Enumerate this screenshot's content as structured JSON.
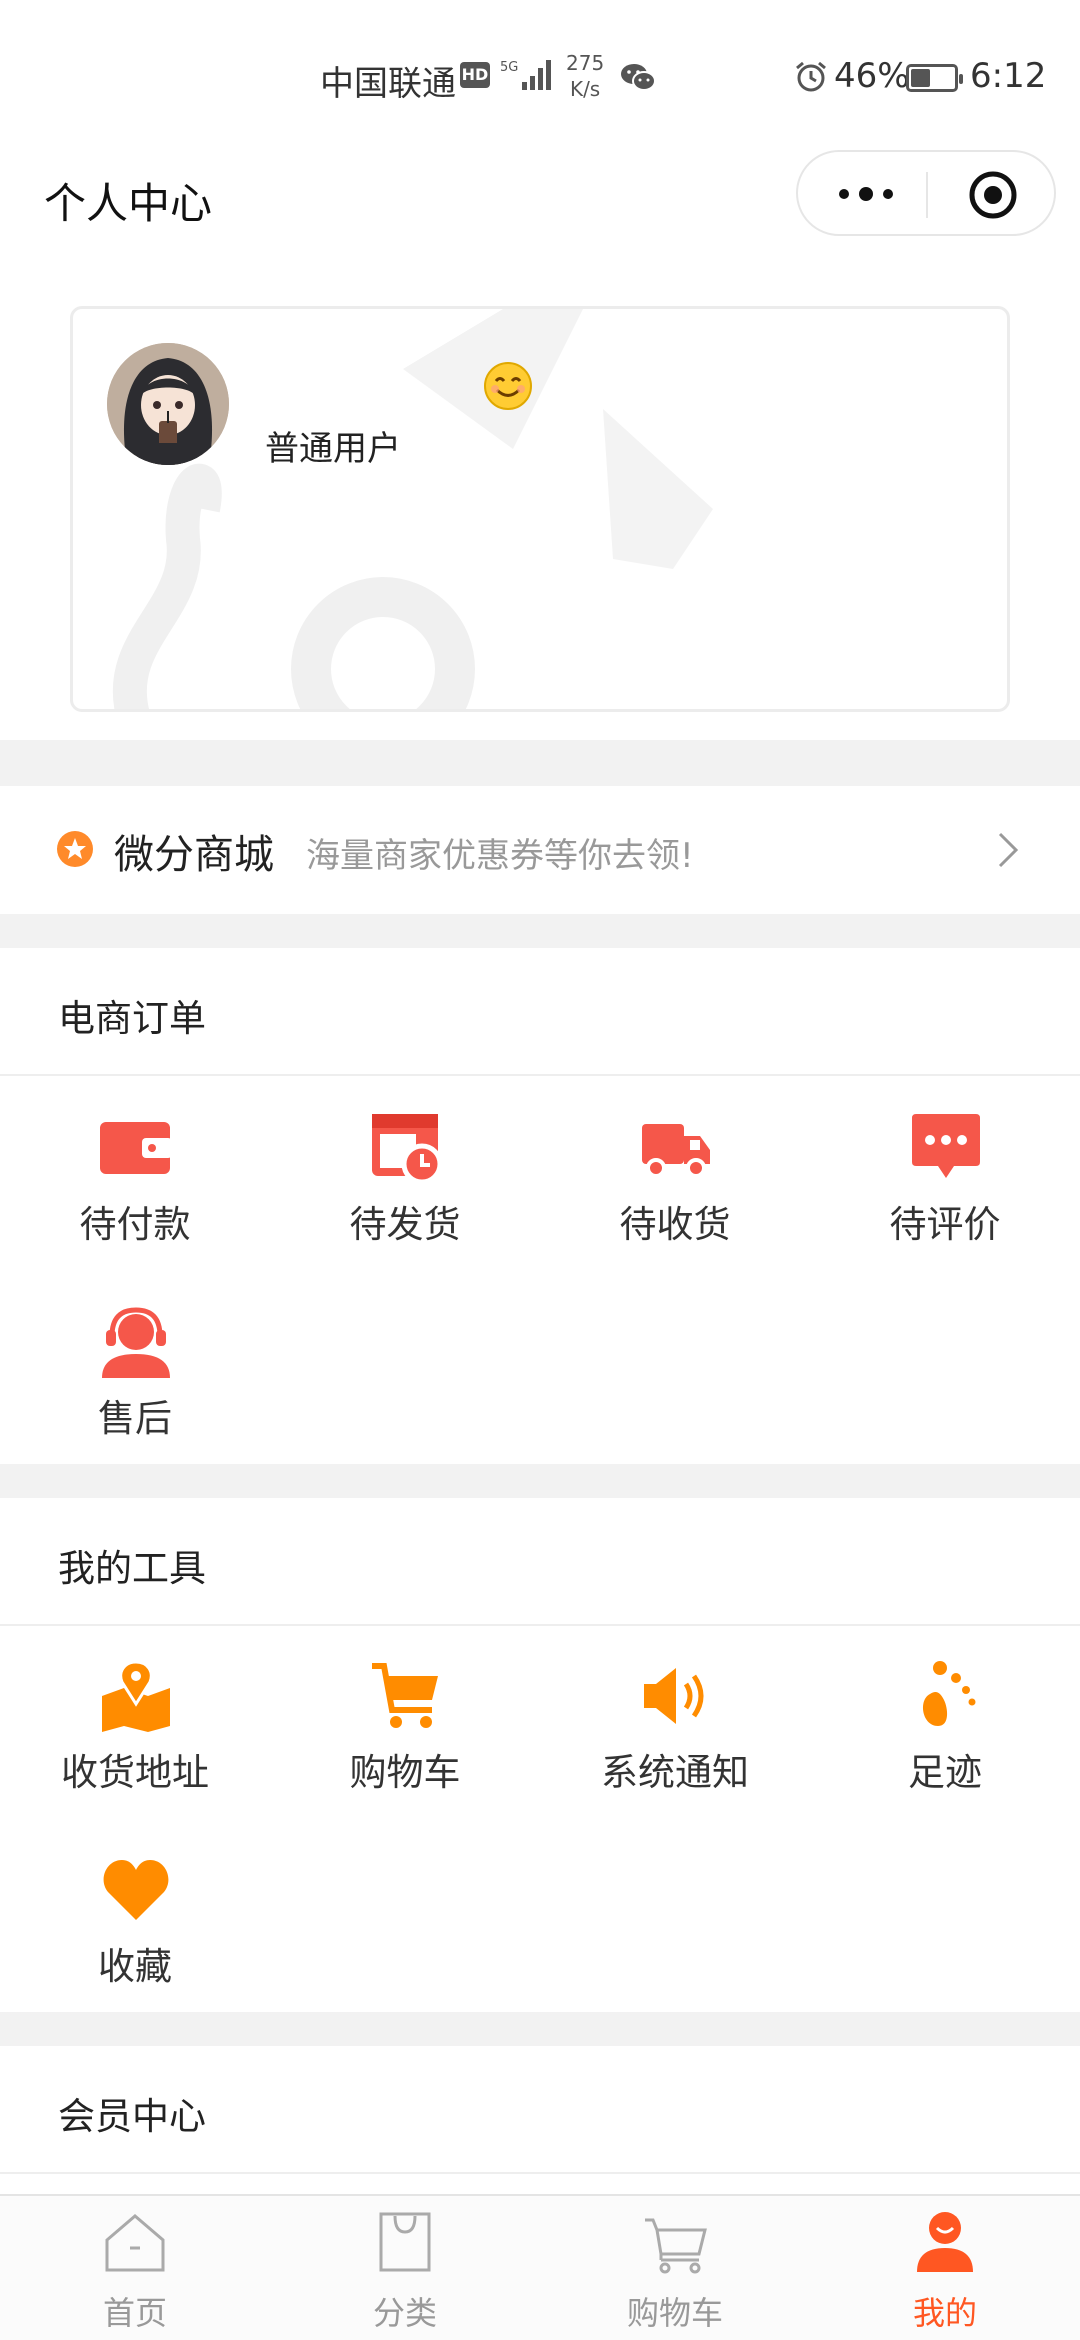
{
  "status_bar": {
    "carrier": "中国联通",
    "network_badge": "HD",
    "network_type": "5G",
    "speed_value": "275",
    "speed_unit": "K/s",
    "battery_percent": "46%",
    "battery_level": 0.46,
    "time": "6:12"
  },
  "nav": {
    "title": "个人中心"
  },
  "profile": {
    "name": "普通用户",
    "emoji": "😊"
  },
  "mall": {
    "title": "微分商城",
    "subtitle": "海量商家优惠券等你去领!"
  },
  "orders": {
    "title": "电商订单",
    "items": [
      {
        "label": "待付款",
        "icon": "wallet-icon"
      },
      {
        "label": "待发货",
        "icon": "calendar-clock-icon"
      },
      {
        "label": "待收货",
        "icon": "truck-icon"
      },
      {
        "label": "待评价",
        "icon": "chat-bubble-icon"
      },
      {
        "label": "售后",
        "icon": "headset-icon"
      }
    ]
  },
  "tools": {
    "title": "我的工具",
    "items": [
      {
        "label": "收货地址",
        "icon": "map-pin-icon"
      },
      {
        "label": "购物车",
        "icon": "cart-icon"
      },
      {
        "label": "系统通知",
        "icon": "speaker-icon"
      },
      {
        "label": "足迹",
        "icon": "footprint-icon"
      },
      {
        "label": "收藏",
        "icon": "heart-icon"
      }
    ]
  },
  "member": {
    "title": "会员中心"
  },
  "tabbar": {
    "items": [
      {
        "label": "首页",
        "icon": "home-icon",
        "active": false
      },
      {
        "label": "分类",
        "icon": "bag-icon",
        "active": false
      },
      {
        "label": "购物车",
        "icon": "cart-icon",
        "active": false
      },
      {
        "label": "我的",
        "icon": "user-icon",
        "active": true
      }
    ]
  },
  "colors": {
    "order_icon_red": "#f5574a",
    "tool_icon_orange": "#ff8c00",
    "tab_active": "#ff5722",
    "tab_inactive": "#999999",
    "separator_gray": "#f2f2f2"
  }
}
